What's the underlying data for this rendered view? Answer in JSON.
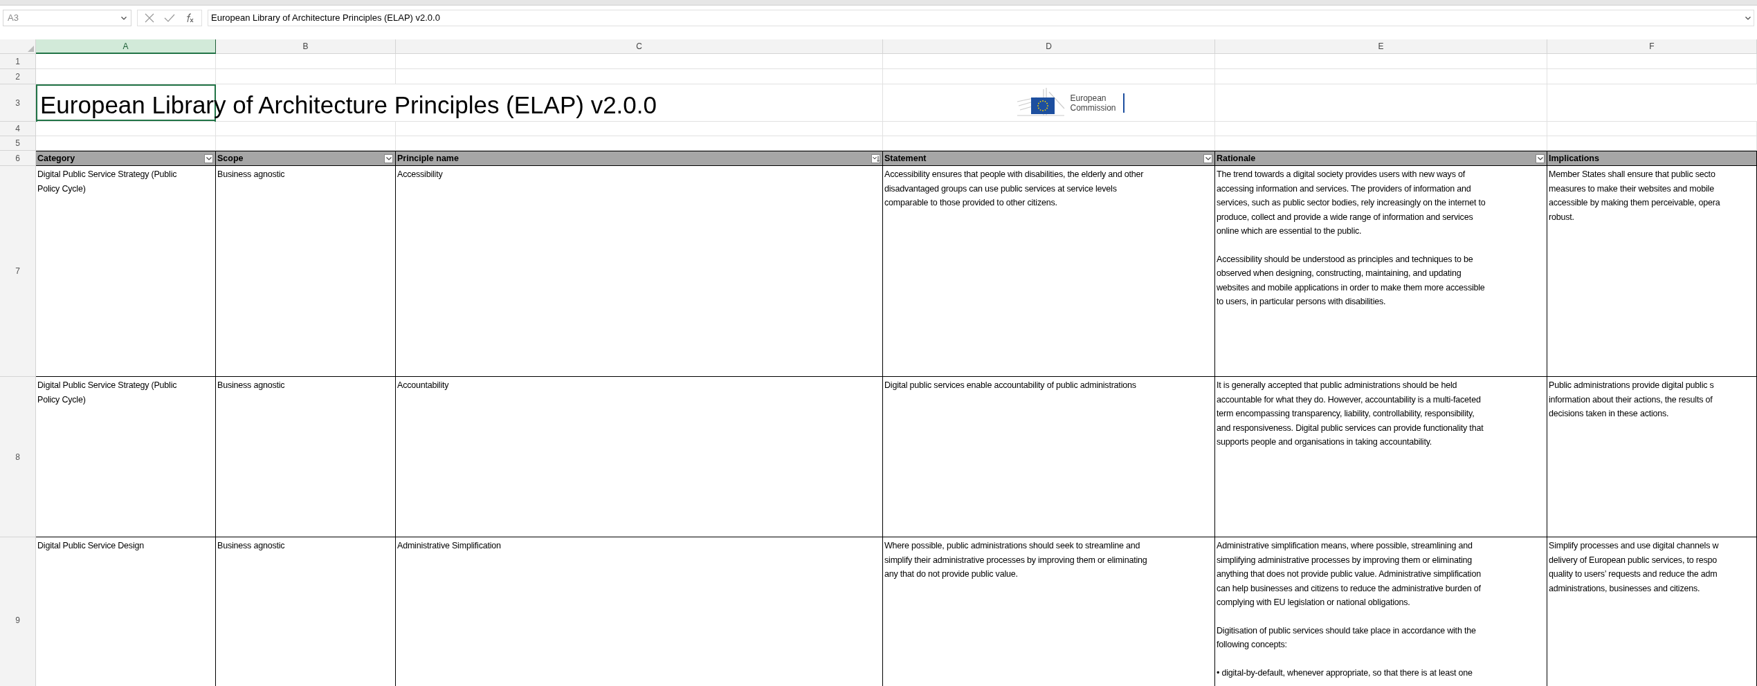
{
  "name_box": "A3",
  "formula": "European Library of Architecture Principles (ELAP) v2.0.0",
  "columns": [
    {
      "letter": "A",
      "selected": true
    },
    {
      "letter": "B",
      "selected": false
    },
    {
      "letter": "C",
      "selected": false
    },
    {
      "letter": "D",
      "selected": false
    },
    {
      "letter": "E",
      "selected": false
    },
    {
      "letter": "F",
      "selected": false
    }
  ],
  "empty_rows": [
    "1",
    "2"
  ],
  "title_row": {
    "row": "3",
    "title": "European Library of Architecture Principles (ELAP) v2.0.0",
    "logo": [
      "European",
      "Commission"
    ]
  },
  "spacer_rows": [
    "4",
    "5"
  ],
  "table": {
    "row": "6",
    "columns": [
      {
        "label": "Category",
        "kind": "filter"
      },
      {
        "label": "Scope",
        "kind": "filter"
      },
      {
        "label": "Principle name",
        "kind": "sorted"
      },
      {
        "label": "Statement",
        "kind": "filter"
      },
      {
        "label": "Rationale",
        "kind": "filter"
      },
      {
        "label": "Implications",
        "kind": "none"
      }
    ],
    "rows": [
      {
        "row": "7",
        "cells": [
          [
            [
              "Digital Public Service Strategy (Public",
              "Policy Cycle)"
            ]
          ],
          [
            [
              "Business agnostic"
            ]
          ],
          [
            [
              "Accessibility"
            ]
          ],
          [
            [
              "Accessibility ensures that people with disabilities, the elderly and other",
              "disadvantaged groups can use public services at service levels",
              "comparable to those provided to other citizens."
            ]
          ],
          [
            [
              "The trend towards a digital society provides users with new ways of",
              "accessing information and services. The providers of information and",
              "services, such as public sector bodies, rely increasingly on the internet to",
              "produce, collect and provide a wide range of information and services",
              "online which are essential to the public."
            ],
            [
              "Accessibility should be understood as principles and techniques to be",
              "observed when designing, constructing, maintaining, and updating",
              "websites and mobile applications in order to make them more accessible",
              "to users, in particular persons with disabilities."
            ]
          ],
          [
            [
              "Member States shall ensure that public secto",
              "measures to make their websites and mobile",
              "accessible by making them perceivable, opera",
              "robust."
            ]
          ]
        ]
      },
      {
        "row": "8",
        "cells": [
          [
            [
              "Digital Public Service Strategy (Public",
              "Policy Cycle)"
            ]
          ],
          [
            [
              "Business agnostic"
            ]
          ],
          [
            [
              "Accountability"
            ]
          ],
          [
            [
              "Digital public services enable accountability of public administrations"
            ]
          ],
          [
            [
              "It is generally accepted that public administrations should be held",
              "accountable for what they do. However, accountability is a multi-faceted",
              "term encompassing transparency, liability, controllability, responsibility,",
              "and responsiveness. Digital public services can provide functionality that",
              "supports people and organisations in taking accountability."
            ]
          ],
          [
            [
              "Public administrations provide digital public s",
              "information about their actions, the results of",
              "decisions taken in these actions."
            ]
          ]
        ]
      },
      {
        "row": "9",
        "cells": [
          [
            [
              "Digital Public Service Design"
            ]
          ],
          [
            [
              "Business agnostic"
            ]
          ],
          [
            [
              "Administrative Simplification"
            ]
          ],
          [
            [
              "Where possible, public administrations should seek to streamline and",
              "simplify their administrative processes by improving them or eliminating",
              "any that do not provide public value."
            ]
          ],
          [
            [
              "Administrative simplification means, where possible, streamlining and",
              "simplifying administrative processes by improving them or eliminating",
              "anything that does not provide public value. Administrative simplification",
              "can help businesses and citizens to reduce the administrative burden of",
              "complying with EU legislation or national obligations."
            ],
            [
              "Digitisation of public services should take place in accordance with the",
              "following concepts:"
            ],
            [
              "• digital-by-default, whenever appropriate, so that there is at least one"
            ]
          ],
          [
            [
              "Simplify processes and use digital channels w",
              "delivery of European public services, to respo",
              "quality to users’ requests and reduce the adm",
              "administrations, businesses and citizens."
            ]
          ]
        ]
      }
    ]
  }
}
